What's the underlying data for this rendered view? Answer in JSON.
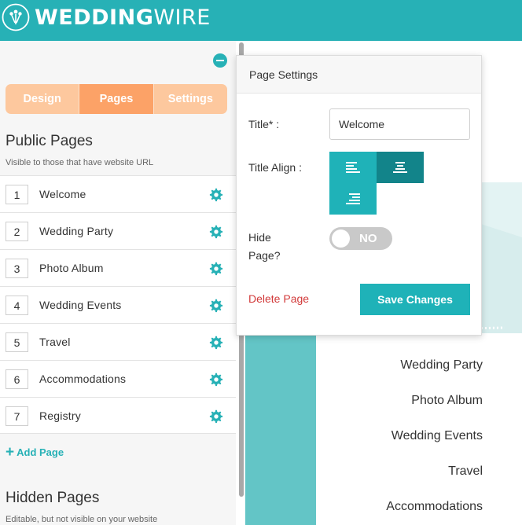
{
  "header": {
    "brand_bold": "WEDDING",
    "brand_light": "WIRE",
    "logo_icon": "bouquet-logo-icon",
    "bg_color": "#27b1b6"
  },
  "sidebar": {
    "tabs": [
      {
        "label": "Design",
        "active": false
      },
      {
        "label": "Pages",
        "active": true
      },
      {
        "label": "Settings",
        "active": false
      }
    ],
    "public_title": "Public Pages",
    "public_sub": "Visible to those that have website URL",
    "pages": [
      {
        "num": "1",
        "name": "Welcome"
      },
      {
        "num": "2",
        "name": "Wedding Party"
      },
      {
        "num": "3",
        "name": "Photo Album"
      },
      {
        "num": "4",
        "name": "Wedding Events"
      },
      {
        "num": "5",
        "name": "Travel"
      },
      {
        "num": "6",
        "name": "Accommodations"
      },
      {
        "num": "7",
        "name": "Registry"
      }
    ],
    "add_page_label": "Add Page",
    "hidden_title": "Hidden Pages",
    "hidden_sub": "Editable, but not visible on your website"
  },
  "popover": {
    "title": "Page Settings",
    "title_label": "Title* :",
    "title_value": "Welcome",
    "align_label": "Title Align :",
    "align_selected": "center",
    "hide_label_1": "Hide",
    "hide_label_2": "Page?",
    "hide_toggle_text": "NO",
    "delete_label": "Delete Page",
    "save_label": "Save Changes"
  },
  "preview": {
    "menu": [
      "Wedding Party",
      "Photo Album",
      "Wedding Events",
      "Travel",
      "Accommodations"
    ]
  },
  "colors": {
    "accent": "#27b1b6",
    "tab_inactive": "#fdc89e",
    "tab_active": "#fca267",
    "delete": "#d23a3a"
  }
}
